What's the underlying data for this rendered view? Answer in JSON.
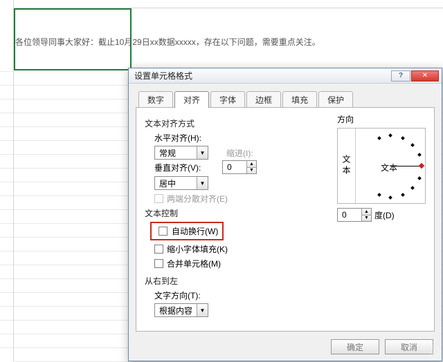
{
  "sheet": {
    "cell_text": "各位领导同事大家好：截止10月29日xx数据xxxxx，存在以下问题，需要重点关注。"
  },
  "dialog": {
    "title": "设置单元格格式",
    "tabs": [
      "数字",
      "对齐",
      "字体",
      "边框",
      "填充",
      "保护"
    ],
    "active_tab_index": 1,
    "align_section": "文本对齐方式",
    "h_label": "水平对齐(H):",
    "h_value": "常规",
    "indent_label": "缩进(I):",
    "indent_value": "0",
    "v_label": "垂直对齐(V):",
    "v_value": "居中",
    "justify_dist": "两端分散对齐(E)",
    "text_control": "文本控制",
    "wrap": "自动换行(W)",
    "shrink": "缩小字体填充(K)",
    "merge": "合并单元格(M)",
    "rtl_section": "从右到左",
    "dir_label": "文字方向(T):",
    "dir_value": "根据内容",
    "orient_label": "方向",
    "orient_vert_text": "文本",
    "orient_center_text": "文本",
    "deg_value": "0",
    "deg_label": "度(D)",
    "ok": "确定",
    "cancel": "取消"
  }
}
